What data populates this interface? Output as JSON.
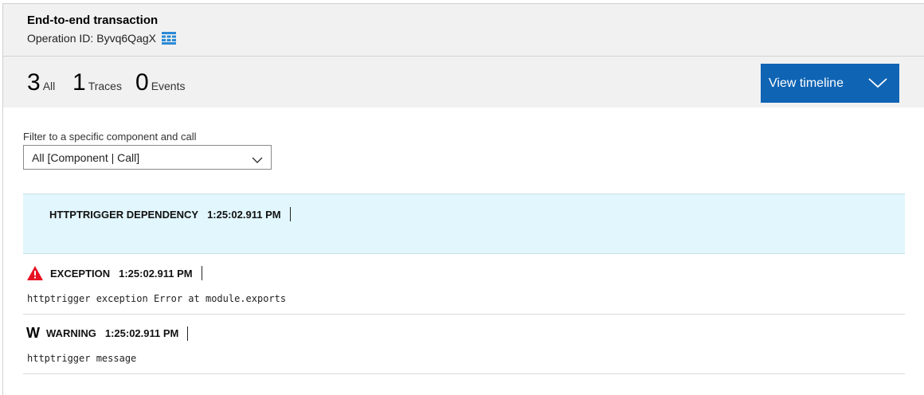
{
  "header": {
    "title": "End-to-end transaction",
    "operation_label": "Operation ID:",
    "operation_id": "Byvq6QagX"
  },
  "summary": {
    "counts": [
      {
        "value": "3",
        "label": "All"
      },
      {
        "value": "1",
        "label": "Traces"
      },
      {
        "value": "0",
        "label": "Events"
      }
    ],
    "view_timeline_label": "View timeline"
  },
  "filter": {
    "label": "Filter to a specific component and call",
    "selected": "All [Component | Call]"
  },
  "rows": [
    {
      "type": "HTTPTRIGGER DEPENDENCY",
      "time": "1:25:02.911 PM",
      "message": ""
    },
    {
      "type": "EXCEPTION",
      "time": "1:25:02.911 PM",
      "message": "httptrigger exception Error at module.exports"
    },
    {
      "type": "WARNING",
      "time": "1:25:02.911 PM",
      "message": "httptrigger message",
      "badge": "W"
    }
  ],
  "colors": {
    "accent": "#0f64b4",
    "selected_row": "#e1f6fd",
    "exception_icon": "#e81123",
    "header_bg": "#f1f1f1"
  },
  "icons": {
    "operation_grid": "grid-icon",
    "dropdown": "chevron-down-icon",
    "exception": "warning-triangle-icon"
  }
}
